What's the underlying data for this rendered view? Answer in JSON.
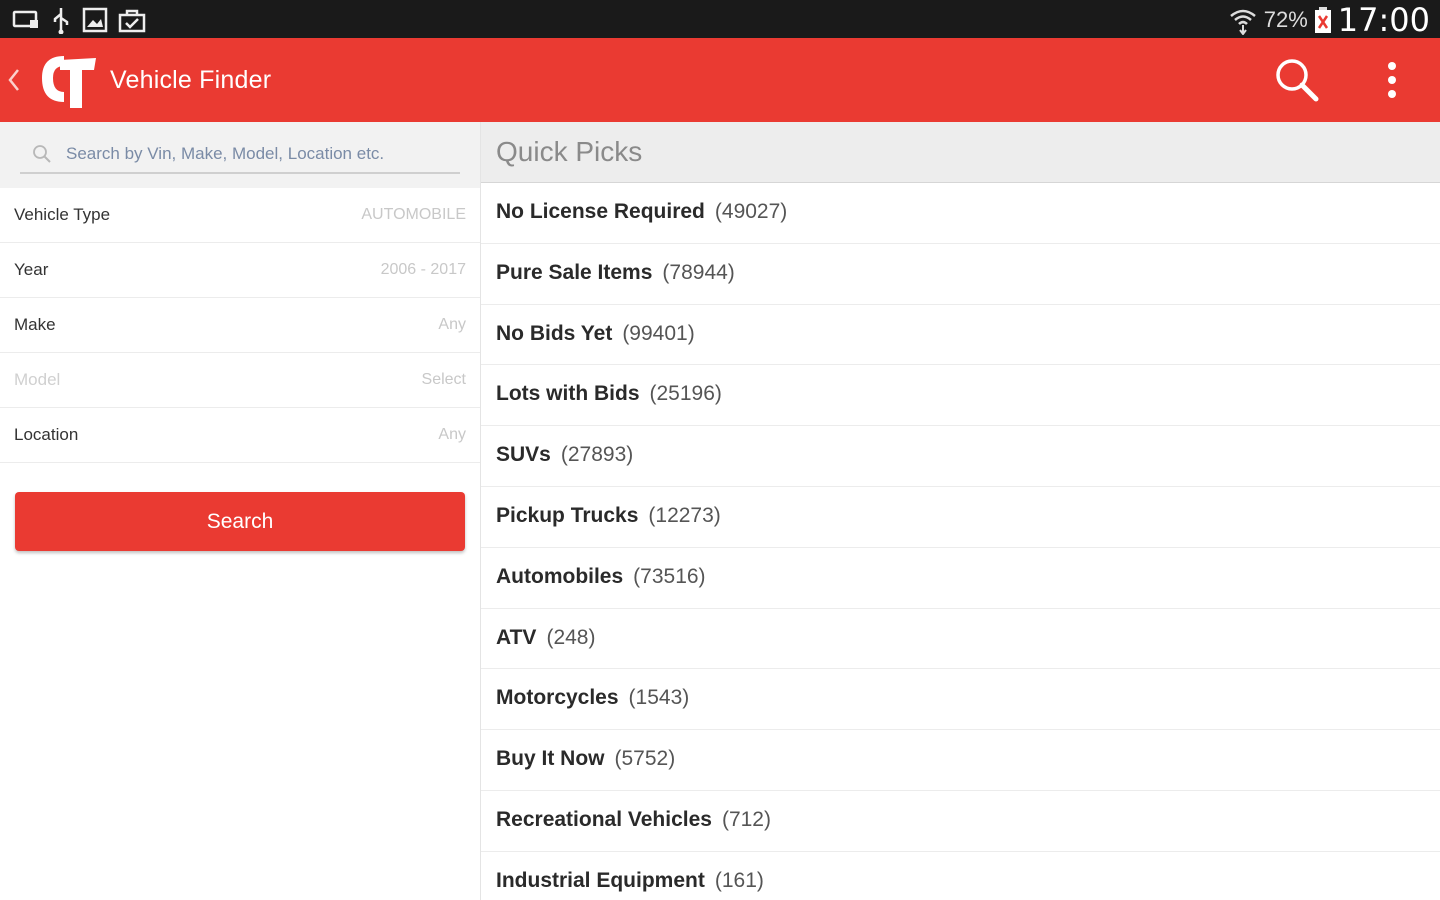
{
  "status_bar": {
    "icons": [
      "screen-cast-icon",
      "usb-icon",
      "gallery-icon",
      "briefcase-icon"
    ],
    "battery": "72%",
    "clock": "17:00"
  },
  "app_bar": {
    "logo": "CT",
    "title": "Vehicle Finder",
    "accent_color": "#ea3a32"
  },
  "search": {
    "placeholder": "Search by Vin, Make, Model, Location etc."
  },
  "filters": [
    {
      "label": "Vehicle Type",
      "value": "AUTOMOBILE"
    },
    {
      "label": "Year",
      "value": "2006 - 2017"
    },
    {
      "label": "Make",
      "value": "Any"
    },
    {
      "label": "Model",
      "value": "Select"
    },
    {
      "label": "Location",
      "value": "Any"
    }
  ],
  "search_button_label": "Search",
  "quick_picks": {
    "title": "Quick Picks",
    "items": [
      {
        "name": "No License Required",
        "count": "(49027)"
      },
      {
        "name": "Pure Sale Items",
        "count": "(78944)"
      },
      {
        "name": "No Bids Yet",
        "count": "(99401)"
      },
      {
        "name": "Lots with Bids",
        "count": "(25196)"
      },
      {
        "name": "SUVs",
        "count": "(27893)"
      },
      {
        "name": "Pickup Trucks",
        "count": "(12273)"
      },
      {
        "name": "Automobiles",
        "count": "(73516)"
      },
      {
        "name": "ATV",
        "count": "(248)"
      },
      {
        "name": "Motorcycles",
        "count": "(1543)"
      },
      {
        "name": "Buy It Now",
        "count": "(5752)"
      },
      {
        "name": "Recreational Vehicles",
        "count": "(712)"
      },
      {
        "name": "Industrial Equipment",
        "count": "(161)"
      }
    ]
  }
}
